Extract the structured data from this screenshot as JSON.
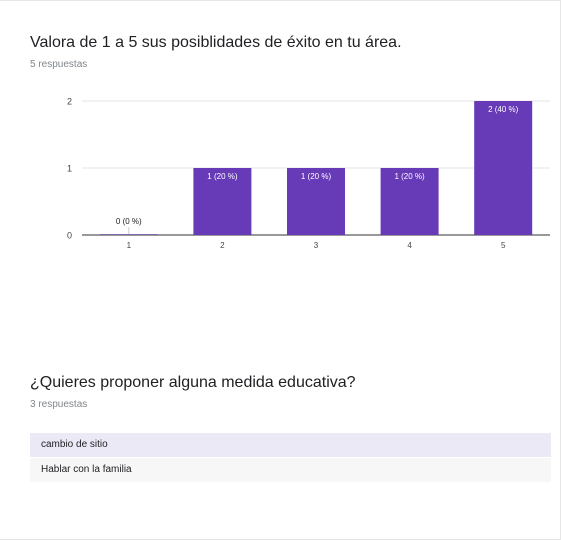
{
  "question1": {
    "title": "Valora de 1 a 5 sus posiblidades de éxito en tu área.",
    "responses": "5 respuestas"
  },
  "chart_data": {
    "type": "bar",
    "categories": [
      "1",
      "2",
      "3",
      "4",
      "5"
    ],
    "values": [
      0,
      1,
      1,
      1,
      2
    ],
    "data_labels": [
      "0 (0 %)",
      "1 (20 %)",
      "1 (20 %)",
      "1 (20 %)",
      "2 (40 %)"
    ],
    "ylim": [
      0,
      2
    ],
    "yticks": [
      "0",
      "1",
      "2"
    ],
    "bar_color": "#673ab7",
    "grid": true
  },
  "question2": {
    "title": "¿Quieres proponer alguna medida educativa?",
    "responses": "3 respuestas",
    "answers": [
      "cambio de sitio",
      "Hablar con la familia"
    ]
  }
}
